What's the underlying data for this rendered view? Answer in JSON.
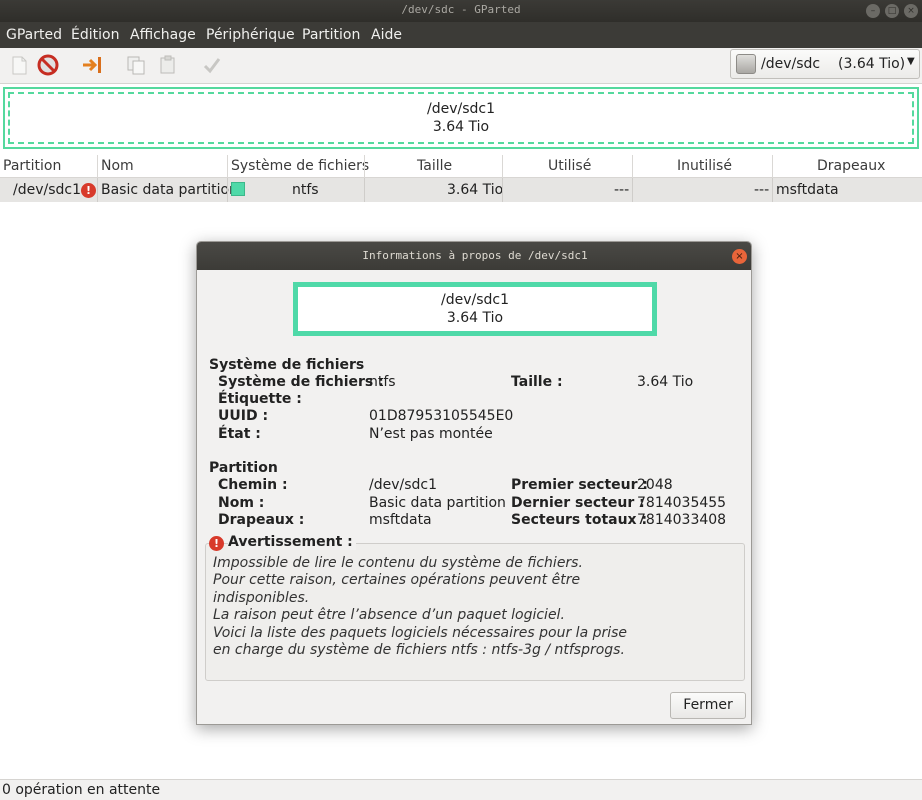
{
  "window": {
    "title": "/dev/sdc - GParted"
  },
  "menu": [
    "GParted",
    "Édition",
    "Affichage",
    "Périphérique",
    "Partition",
    "Aide"
  ],
  "toolbar": {
    "icons": [
      "new-partition-icon",
      "delete-icon",
      "resize-move-icon",
      "copy-icon",
      "paste-icon",
      "apply-icon"
    ]
  },
  "device_selector": {
    "device": "/dev/sdc",
    "size": "(3.64 Tio)"
  },
  "disk_map": {
    "name": "/dev/sdc1",
    "size": "3.64 Tio"
  },
  "table": {
    "headers": [
      "Partition",
      "Nom",
      "Système de fichiers",
      "Taille",
      "Utilisé",
      "Inutilisé",
      "Drapeaux"
    ],
    "rows": [
      {
        "partition": "/dev/sdc1",
        "nom": "Basic data partition",
        "fs": "ntfs",
        "taille": "3.64 Tio",
        "utilise": "---",
        "inutilise": "---",
        "drapeaux": "msftdata",
        "fs_color": "#4fd9a8"
      }
    ]
  },
  "dialog": {
    "title": "Informations à propos de /dev/sdc1",
    "map": {
      "name": "/dev/sdc1",
      "size": "3.64 Tio"
    },
    "fs_section": {
      "heading": "Système de fichiers",
      "fs_label": "Système de fichiers :",
      "fs_value": "ntfs",
      "size_label": "Taille :",
      "size_value": "3.64 Tio",
      "label_label": "Étiquette :",
      "uuid_label": "UUID :",
      "uuid_value": "01D87953105545E0",
      "state_label": "État :",
      "state_value": "N’est pas montée"
    },
    "part_section": {
      "heading": "Partition",
      "path_label": "Chemin :",
      "path_value": "/dev/sdc1",
      "name_label": "Nom :",
      "name_value": "Basic data partition",
      "flags_label": "Drapeaux :",
      "flags_value": "msftdata",
      "first_label": "Premier secteur :",
      "first_value": "2048",
      "last_label": "Dernier secteur :",
      "last_value": "7814035455",
      "total_label": "Secteurs totaux :",
      "total_value": "7814033408"
    },
    "warning": {
      "heading": "Avertissement :",
      "lines": [
        "Impossible de lire le contenu du système de fichiers.",
        "Pour cette raison, certaines opérations peuvent être",
        "indisponibles.",
        "La raison peut être l’absence d’un paquet logiciel.",
        "Voici la liste des paquets logiciels nécessaires pour la prise",
        "en charge du système de fichiers ntfs : ntfs-3g / ntfsprogs."
      ]
    },
    "close_button": "Fermer"
  },
  "status": "0 opération en attente"
}
